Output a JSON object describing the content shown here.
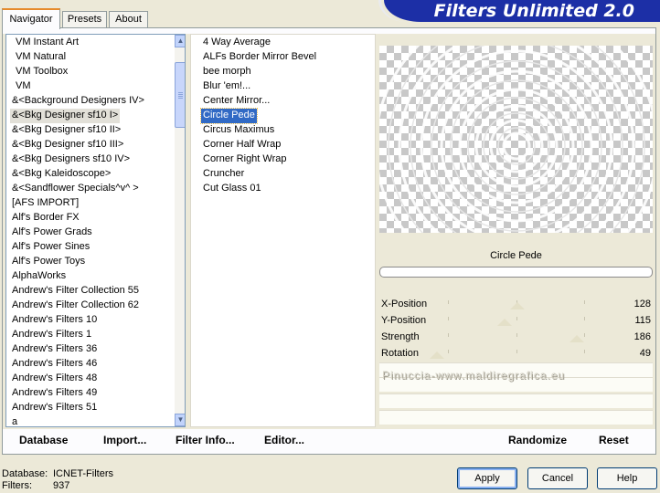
{
  "tabs": [
    {
      "label": "Navigator",
      "active": true
    },
    {
      "label": "Presets",
      "active": false
    },
    {
      "label": "About",
      "active": false
    }
  ],
  "app_title": "Filters Unlimited 2.0",
  "categories": [
    "VM Instant Art",
    "VM Natural",
    "VM Toolbox",
    "VM",
    "&<Background Designers IV>",
    "&<Bkg Designer sf10 I>",
    "&<Bkg Designer sf10 II>",
    "&<Bkg Designer sf10 III>",
    "&<Bkg Designers sf10 IV>",
    "&<Bkg Kaleidoscope>",
    "&<Sandflower Specials^v^ >",
    "[AFS IMPORT]",
    "Alf's Border FX",
    "Alf's Power Grads",
    "Alf's Power Sines",
    "Alf's Power Toys",
    "AlphaWorks",
    "Andrew's Filter Collection 55",
    "Andrew's Filter Collection 62",
    "Andrew's Filters 10",
    "Andrew's Filters 1",
    "Andrew's Filters 36",
    "Andrew's Filters 46",
    "Andrew's Filters 48",
    "Andrew's Filters 49",
    "Andrew's Filters 51",
    "a"
  ],
  "selected_category": "&<Bkg Designer sf10 I>",
  "filters": [
    "4 Way Average",
    "ALFs Border Mirror Bevel",
    "bee morph",
    "Blur 'em!...",
    "Center Mirror...",
    "Circle Pede",
    "Circus Maximus",
    "Corner Half Wrap",
    "Corner Right Wrap",
    "Cruncher",
    "Cut Glass 01"
  ],
  "selected_filter": "Circle Pede",
  "preview_filter_name": "Circle Pede",
  "parameters": [
    {
      "label": "X-Position",
      "value": "128",
      "level": 128
    },
    {
      "label": "Y-Position",
      "value": "115",
      "level": 115
    },
    {
      "label": "Strength",
      "value": "186",
      "level": 186
    },
    {
      "label": "Rotation",
      "value": "49",
      "level": 49
    }
  ],
  "parameter_max": 255,
  "watermark": "Pinuccia-www.maldiregrafica.eu",
  "bottom_buttons": {
    "database": "Database",
    "import": "Import...",
    "filter_info": "Filter Info...",
    "editor": "Editor...",
    "randomize": "Randomize",
    "reset": "Reset"
  },
  "status": {
    "database_label": "Database:",
    "database_value": "ICNET-Filters",
    "filters_label": "Filters:",
    "filters_value": "937"
  },
  "dialog_buttons": {
    "apply": "Apply",
    "cancel": "Cancel",
    "help": "Help"
  },
  "colors": {
    "title_bg": "#1c2fa6",
    "selection": "#316ac5",
    "panel": "#ece9d8"
  },
  "icons": {
    "scroll_up": "triangle-up",
    "scroll_down": "triangle-down"
  }
}
